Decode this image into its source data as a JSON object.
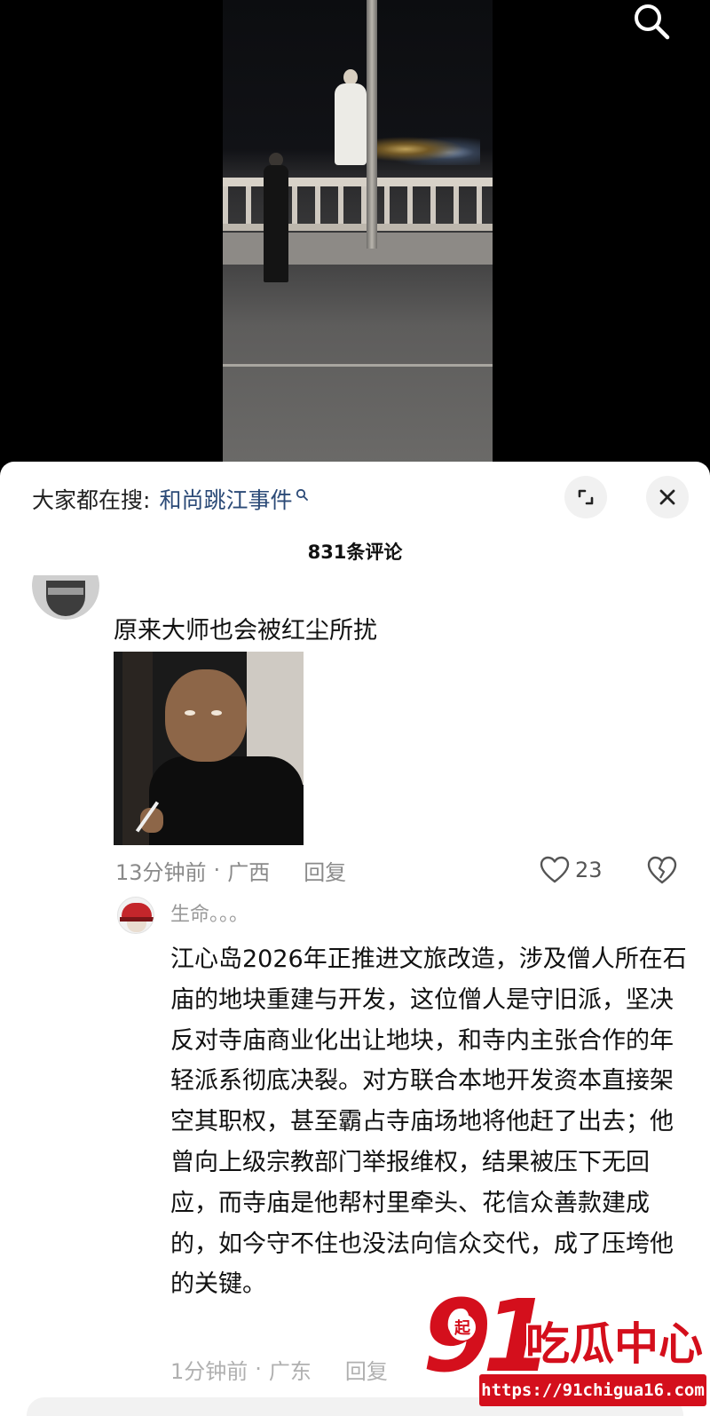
{
  "trending": {
    "label": "大家都在搜:",
    "query": "和尚跳江事件"
  },
  "comments_header": {
    "count_text": "831条评论"
  },
  "comment": {
    "text": "原来大师也会被红尘所扰",
    "time": "13分钟前",
    "separator": "·",
    "location": "广西",
    "reply_label": "回复",
    "likes": "23"
  },
  "reply": {
    "author": "生命。。。",
    "text": "江心岛2026年正推进文旅改造，涉及僧人所在石庙的地块重建与开发，这位僧人是守旧派，坚决反对寺庙商业化出让地块，和寺内主张合作的年轻派系彻底决裂。对方联合本地开发资本直接架空其职权，甚至霸占寺庙场地将他赶了出去；他曾向上级宗教部门举报维权，结果被压下无回应，而寺庙是他帮村里牵头、花信众善款建成的，如今守不住也没法向信众交代，成了压垮他的关键。",
    "time": "1分钟前",
    "separator": "·",
    "location": "广东",
    "reply_label": "回复"
  },
  "watermark": {
    "number": "91",
    "badge": "起",
    "brand": "吃瓜中心",
    "url": "https://91chigua16.com"
  },
  "icons": {
    "search": "search-icon",
    "expand": "expand-icon",
    "close": "close-icon",
    "like": "heart-icon",
    "dislike": "broken-heart-icon"
  },
  "colors": {
    "link": "#2b4a77",
    "watermark_red": "#d40f1c",
    "meta_gray": "#8a8a8a"
  }
}
